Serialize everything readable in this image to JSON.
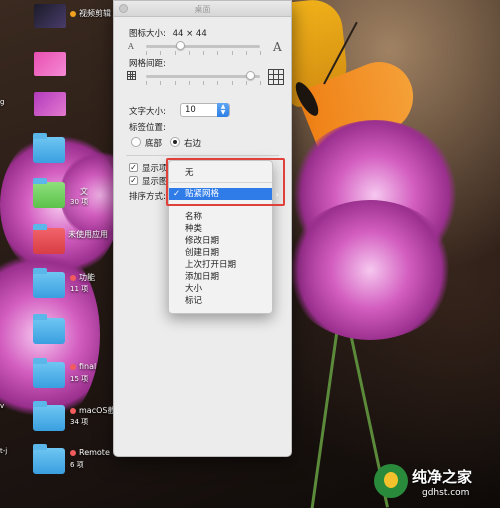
{
  "desktop": {
    "icons": [
      {
        "name": "视频剪辑",
        "sub": "",
        "tag_color": "#f2a21e",
        "kind": "thumb-dark"
      },
      {
        "name": "",
        "sub": "",
        "kind": "thumb-pink"
      },
      {
        "name": "",
        "sub": "",
        "kind": "thumb-purple"
      },
      {
        "name": "",
        "sub": "",
        "kind": "folder"
      },
      {
        "name": "文",
        "sub": "30 项",
        "kind": "folder-green"
      },
      {
        "name": "未使用应用",
        "sub": "",
        "kind": "folder-red"
      },
      {
        "name": "功能",
        "sub": "11 项",
        "kind": "folder"
      },
      {
        "name": "",
        "sub": "",
        "kind": "folder"
      },
      {
        "name": "final",
        "sub": "15 项",
        "kind": "folder"
      },
      {
        "name": "macOS截",
        "sub": "34 项",
        "kind": "folder"
      },
      {
        "name": "Remote",
        "sub": "6 项",
        "kind": "folder"
      }
    ],
    "edge_labels": [
      "g",
      "v",
      "t-j"
    ]
  },
  "panel": {
    "title": "桌面",
    "icon_size_label": "图标大小:",
    "icon_size_value": "44 × 44",
    "icon_size_level": 0.3,
    "grid_spacing_label": "网格间距:",
    "grid_spacing_level": 0.92,
    "text_size_label": "文字大小:",
    "text_size_value": "10",
    "label_position_label": "标签位置:",
    "label_position_bottom": "底部",
    "label_position_right": "右边",
    "label_position_selected": "right",
    "show_item_info_label": "显示项",
    "show_icon_preview_label": "显示图",
    "sort_label": "排序方式:"
  },
  "menu": {
    "items": [
      {
        "label": "无",
        "checked": false,
        "selected": false
      },
      {
        "label": "贴紧网格",
        "checked": true,
        "selected": true
      },
      {
        "label": "名称",
        "checked": false,
        "selected": false
      },
      {
        "label": "种类",
        "checked": false,
        "selected": false
      },
      {
        "label": "修改日期",
        "checked": false,
        "selected": false
      },
      {
        "label": "创建日期",
        "checked": false,
        "selected": false
      },
      {
        "label": "上次打开日期",
        "checked": false,
        "selected": false
      },
      {
        "label": "添加日期",
        "checked": false,
        "selected": false
      },
      {
        "label": "大小",
        "checked": false,
        "selected": false
      },
      {
        "label": "标记",
        "checked": false,
        "selected": false
      }
    ],
    "checkmark": "✓",
    "highlight_color": "#e0403a",
    "selection_color": "#2f7ce9"
  },
  "watermark": {
    "title": "纯净之家",
    "url": "gdhst.com"
  }
}
